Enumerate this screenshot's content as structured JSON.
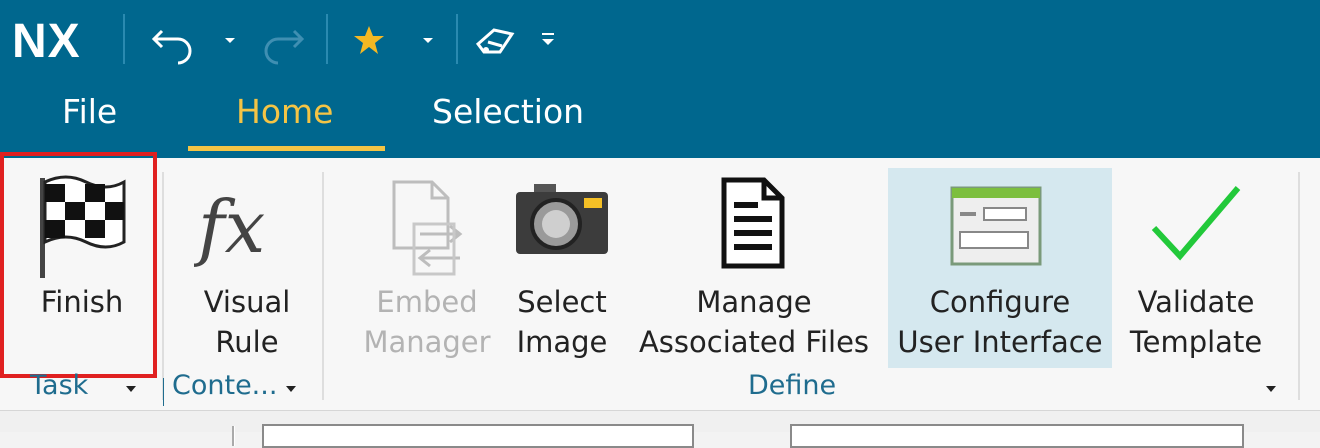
{
  "app": {
    "logo": "NX"
  },
  "quick_access": {
    "undo_icon": "undo-icon",
    "redo_icon": "redo-icon",
    "favorite_icon": "star-icon",
    "tool_icon": "eraser-icon"
  },
  "tabs": [
    {
      "label": "File",
      "active": false
    },
    {
      "label": "Home",
      "active": true
    },
    {
      "label": "Selection",
      "active": false
    }
  ],
  "ribbon": {
    "buttons": [
      {
        "label": "Finish",
        "icon": "checkered-flag-icon",
        "enabled": true,
        "highlighted": true
      },
      {
        "label": "Visual\nRule",
        "icon": "fx-icon",
        "enabled": true
      },
      {
        "label": "Embed\nManager",
        "icon": "embed-document-icon",
        "enabled": false
      },
      {
        "label": "Select\nImage",
        "icon": "camera-icon",
        "enabled": true
      },
      {
        "label": "Manage\nAssociated Files",
        "icon": "document-icon",
        "enabled": true
      },
      {
        "label": "Configure\nUser Interface",
        "icon": "window-form-icon",
        "enabled": true,
        "hovered": true
      },
      {
        "label": "Validate\nTemplate",
        "icon": "checkmark-icon",
        "enabled": true
      }
    ],
    "groups": [
      {
        "label": "Task"
      },
      {
        "label": "Conte..."
      },
      {
        "label": "Define"
      }
    ]
  },
  "colors": {
    "title_bar": "#00678e",
    "active_tab": "#f4c445",
    "highlight_border": "#e02020",
    "hover_bg": "#d5e8ef",
    "group_label": "#1f6c8e"
  }
}
